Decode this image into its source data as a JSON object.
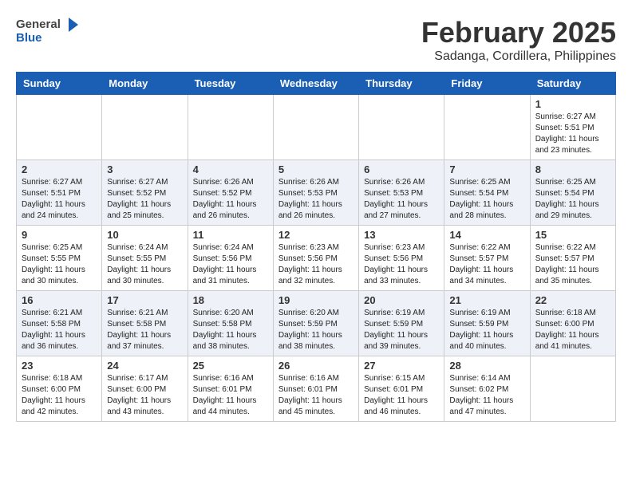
{
  "header": {
    "logo_general": "General",
    "logo_blue": "Blue",
    "month_title": "February 2025",
    "location": "Sadanga, Cordillera, Philippines"
  },
  "weekdays": [
    "Sunday",
    "Monday",
    "Tuesday",
    "Wednesday",
    "Thursday",
    "Friday",
    "Saturday"
  ],
  "weeks": [
    [
      {
        "day": "",
        "info": ""
      },
      {
        "day": "",
        "info": ""
      },
      {
        "day": "",
        "info": ""
      },
      {
        "day": "",
        "info": ""
      },
      {
        "day": "",
        "info": ""
      },
      {
        "day": "",
        "info": ""
      },
      {
        "day": "1",
        "info": "Sunrise: 6:27 AM\nSunset: 5:51 PM\nDaylight: 11 hours\nand 23 minutes."
      }
    ],
    [
      {
        "day": "2",
        "info": "Sunrise: 6:27 AM\nSunset: 5:51 PM\nDaylight: 11 hours\nand 24 minutes."
      },
      {
        "day": "3",
        "info": "Sunrise: 6:27 AM\nSunset: 5:52 PM\nDaylight: 11 hours\nand 25 minutes."
      },
      {
        "day": "4",
        "info": "Sunrise: 6:26 AM\nSunset: 5:52 PM\nDaylight: 11 hours\nand 26 minutes."
      },
      {
        "day": "5",
        "info": "Sunrise: 6:26 AM\nSunset: 5:53 PM\nDaylight: 11 hours\nand 26 minutes."
      },
      {
        "day": "6",
        "info": "Sunrise: 6:26 AM\nSunset: 5:53 PM\nDaylight: 11 hours\nand 27 minutes."
      },
      {
        "day": "7",
        "info": "Sunrise: 6:25 AM\nSunset: 5:54 PM\nDaylight: 11 hours\nand 28 minutes."
      },
      {
        "day": "8",
        "info": "Sunrise: 6:25 AM\nSunset: 5:54 PM\nDaylight: 11 hours\nand 29 minutes."
      }
    ],
    [
      {
        "day": "9",
        "info": "Sunrise: 6:25 AM\nSunset: 5:55 PM\nDaylight: 11 hours\nand 30 minutes."
      },
      {
        "day": "10",
        "info": "Sunrise: 6:24 AM\nSunset: 5:55 PM\nDaylight: 11 hours\nand 30 minutes."
      },
      {
        "day": "11",
        "info": "Sunrise: 6:24 AM\nSunset: 5:56 PM\nDaylight: 11 hours\nand 31 minutes."
      },
      {
        "day": "12",
        "info": "Sunrise: 6:23 AM\nSunset: 5:56 PM\nDaylight: 11 hours\nand 32 minutes."
      },
      {
        "day": "13",
        "info": "Sunrise: 6:23 AM\nSunset: 5:56 PM\nDaylight: 11 hours\nand 33 minutes."
      },
      {
        "day": "14",
        "info": "Sunrise: 6:22 AM\nSunset: 5:57 PM\nDaylight: 11 hours\nand 34 minutes."
      },
      {
        "day": "15",
        "info": "Sunrise: 6:22 AM\nSunset: 5:57 PM\nDaylight: 11 hours\nand 35 minutes."
      }
    ],
    [
      {
        "day": "16",
        "info": "Sunrise: 6:21 AM\nSunset: 5:58 PM\nDaylight: 11 hours\nand 36 minutes."
      },
      {
        "day": "17",
        "info": "Sunrise: 6:21 AM\nSunset: 5:58 PM\nDaylight: 11 hours\nand 37 minutes."
      },
      {
        "day": "18",
        "info": "Sunrise: 6:20 AM\nSunset: 5:58 PM\nDaylight: 11 hours\nand 38 minutes."
      },
      {
        "day": "19",
        "info": "Sunrise: 6:20 AM\nSunset: 5:59 PM\nDaylight: 11 hours\nand 38 minutes."
      },
      {
        "day": "20",
        "info": "Sunrise: 6:19 AM\nSunset: 5:59 PM\nDaylight: 11 hours\nand 39 minutes."
      },
      {
        "day": "21",
        "info": "Sunrise: 6:19 AM\nSunset: 5:59 PM\nDaylight: 11 hours\nand 40 minutes."
      },
      {
        "day": "22",
        "info": "Sunrise: 6:18 AM\nSunset: 6:00 PM\nDaylight: 11 hours\nand 41 minutes."
      }
    ],
    [
      {
        "day": "23",
        "info": "Sunrise: 6:18 AM\nSunset: 6:00 PM\nDaylight: 11 hours\nand 42 minutes."
      },
      {
        "day": "24",
        "info": "Sunrise: 6:17 AM\nSunset: 6:00 PM\nDaylight: 11 hours\nand 43 minutes."
      },
      {
        "day": "25",
        "info": "Sunrise: 6:16 AM\nSunset: 6:01 PM\nDaylight: 11 hours\nand 44 minutes."
      },
      {
        "day": "26",
        "info": "Sunrise: 6:16 AM\nSunset: 6:01 PM\nDaylight: 11 hours\nand 45 minutes."
      },
      {
        "day": "27",
        "info": "Sunrise: 6:15 AM\nSunset: 6:01 PM\nDaylight: 11 hours\nand 46 minutes."
      },
      {
        "day": "28",
        "info": "Sunrise: 6:14 AM\nSunset: 6:02 PM\nDaylight: 11 hours\nand 47 minutes."
      },
      {
        "day": "",
        "info": ""
      }
    ]
  ]
}
